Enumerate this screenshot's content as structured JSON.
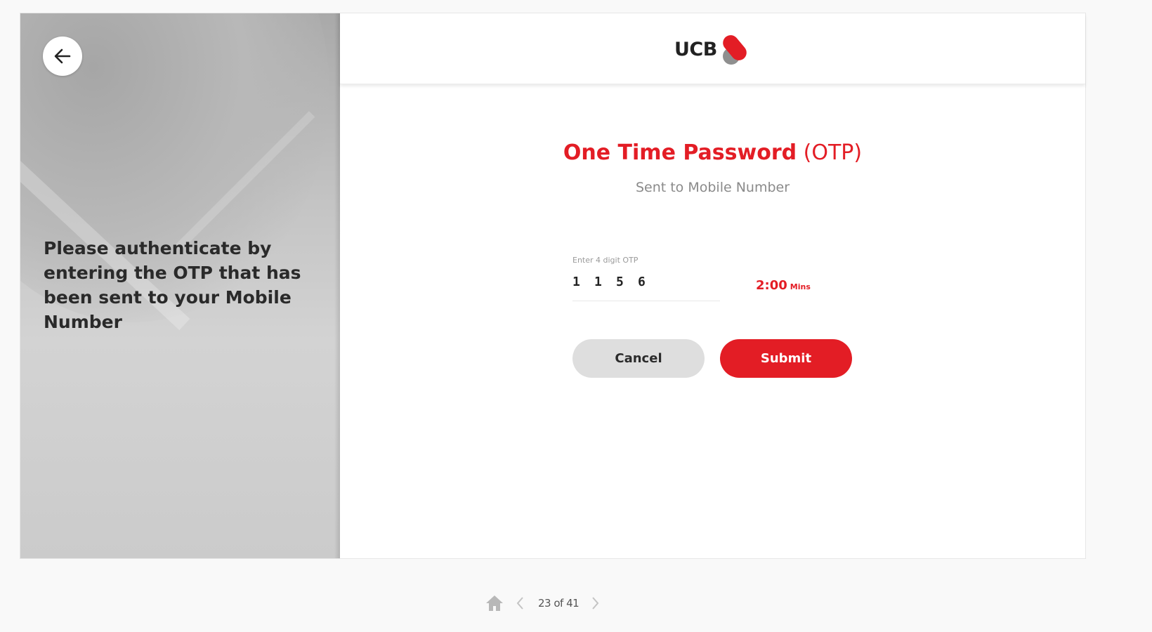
{
  "left_panel": {
    "back_icon": "arrow-left-icon",
    "message": "Please authenticate by entering the OTP that has been sent to your Mobile Number"
  },
  "header": {
    "logo_text": "UCB",
    "logo_icon": "ucb-logo-icon"
  },
  "otp": {
    "title_strong": "One Time Password",
    "title_light": "(OTP)",
    "subtitle": "Sent to Mobile Number",
    "field_label": "Enter 4 digit OTP",
    "digits": [
      "1",
      "1",
      "5",
      "6"
    ],
    "timer_value": "2:00",
    "timer_unit": "Mins"
  },
  "actions": {
    "cancel_label": "Cancel",
    "submit_label": "Submit"
  },
  "pager": {
    "home_icon": "home-icon",
    "prev_icon": "chevron-left-icon",
    "next_icon": "chevron-right-icon",
    "text": "23 of 41"
  },
  "colors": {
    "brand_red": "#e31d25",
    "button_gray": "#dedede",
    "panel_gray": "#c4c4c4"
  }
}
